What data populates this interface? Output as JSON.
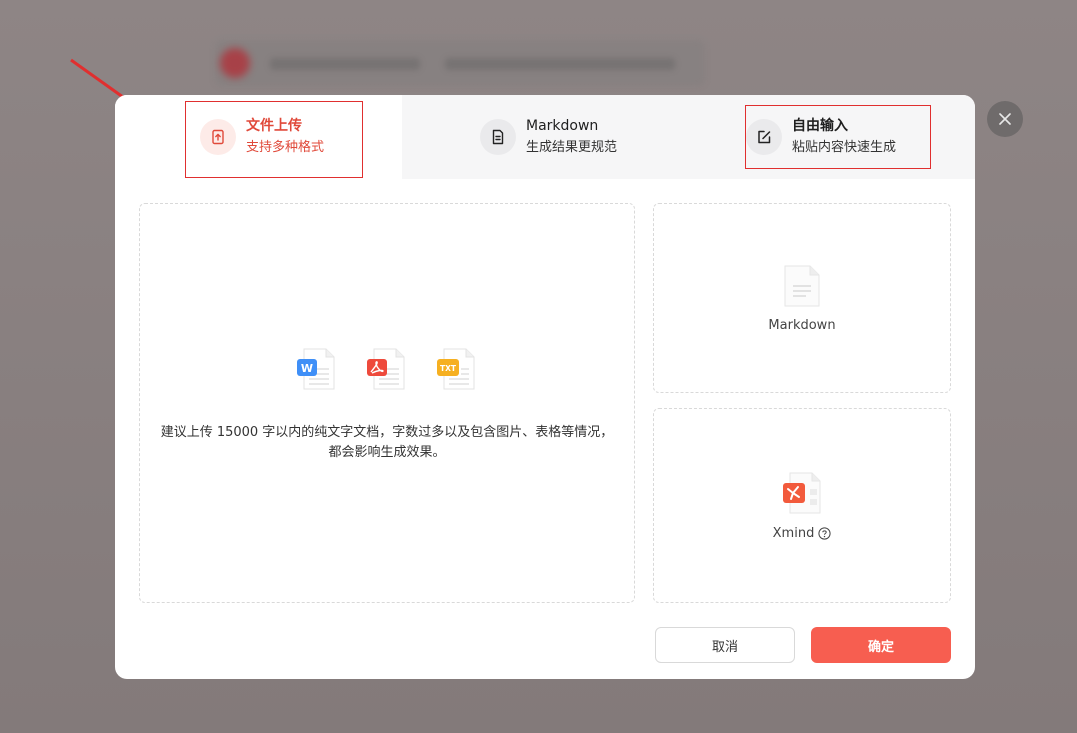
{
  "tabs": [
    {
      "title": "文件上传",
      "subtitle": "支持多种格式",
      "icon": "upload-file-icon",
      "active": true
    },
    {
      "title": "Markdown",
      "subtitle": "生成结果更规范",
      "icon": "document-icon",
      "active": false
    },
    {
      "title": "自由输入",
      "subtitle": "粘贴内容快速生成",
      "icon": "edit-icon",
      "active": false
    }
  ],
  "dropzone": {
    "file_types": [
      "word-file-icon",
      "pdf-file-icon",
      "txt-file-icon"
    ],
    "hint": "建议上传 15000 字以内的纯文字文档，字数过多以及包含图片、表格等情况，都会影响生成效果。"
  },
  "cards": {
    "markdown": {
      "label": "Markdown",
      "icon": "markdown-file-icon"
    },
    "xmind": {
      "label": "Xmind",
      "icon": "xmind-file-icon"
    }
  },
  "footer": {
    "cancel_label": "取消",
    "ok_label": "确定"
  },
  "colors": {
    "accent": "#f75e50",
    "annotation": "#e02f2f",
    "active_text": "#e0493a"
  }
}
